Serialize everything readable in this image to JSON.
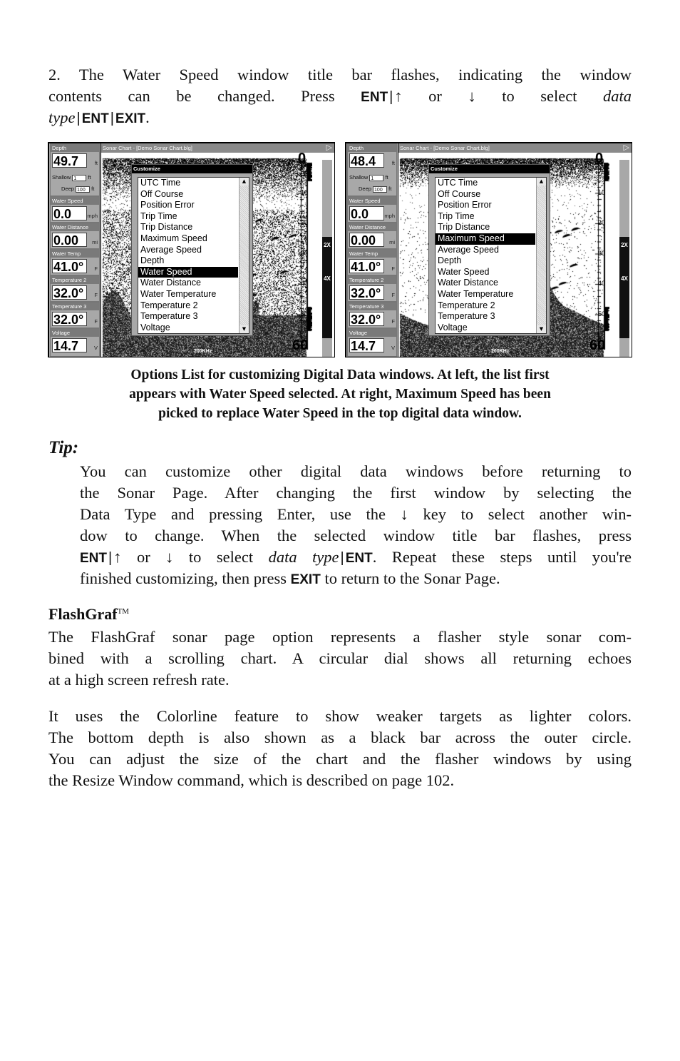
{
  "step2": {
    "line1": "2. The Water Speed window title bar flashes, indicating the window",
    "line2_a": "contents can be changed. Press",
    "key_ent": "ENT",
    "sep": "|",
    "up_arrow": "↑",
    "word_or": "or",
    "down_arrow": "↓",
    "line2_b": "to select",
    "data_word": "data",
    "type_word": "type",
    "key_exit": "EXIT",
    "period": "."
  },
  "screenshots": [
    {
      "side": "left",
      "chart_title": "Sonar Chart - [Demo Sonar Chart.blg]",
      "digital_windows": [
        {
          "title": "Depth",
          "value": "49.7",
          "unit": "ft"
        },
        {
          "title": "Water Speed",
          "value": "0.0",
          "unit": "mph"
        },
        {
          "title": "Water Distance",
          "value": "0.00",
          "unit": "mi"
        },
        {
          "title": "Water Temp",
          "value": "41.0°",
          "unit": "F"
        },
        {
          "title": "Temperature 2",
          "value": "32.0°",
          "unit": "F"
        },
        {
          "title": "Temperature 3",
          "value": "32.0°",
          "unit": "F"
        },
        {
          "title": "Voltage",
          "value": "14.7",
          "unit": "V"
        }
      ],
      "shallow_label": "Shallow",
      "shallow_value": "1",
      "shallow_unit": "ft",
      "deep_label": "Deep",
      "deep_value": "100",
      "deep_unit": "ft",
      "customize_title": "Customize",
      "selected_index": 8,
      "options": [
        "UTC Time",
        "Off Course",
        "Position Error",
        "Trip Time",
        "Trip Distance",
        "Maximum Speed",
        "Average Speed",
        "Depth",
        "Water Speed",
        "Water Distance",
        "Water Temperature",
        "Temperature 2",
        "Temperature 3",
        "Voltage"
      ],
      "depth_scale_top": "0",
      "depth_scale_bottom": "60",
      "depth_scale_ticks": [
        "10",
        "20",
        "30",
        "40",
        "50"
      ],
      "zoom_labels": [
        "2X",
        "4X"
      ],
      "frequency": "200KHz",
      "play_icon": "▷"
    },
    {
      "side": "right",
      "chart_title": "Sonar Chart - [Demo Sonar Chart.blg]",
      "digital_windows": [
        {
          "title": "Depth",
          "value": "48.4",
          "unit": "ft"
        },
        {
          "title": "Water Speed",
          "value": "0.0",
          "unit": "mph"
        },
        {
          "title": "Water Distance",
          "value": "0.00",
          "unit": "mi"
        },
        {
          "title": "Water Temp",
          "value": "41.0°",
          "unit": "F"
        },
        {
          "title": "Temperature 2",
          "value": "32.0°",
          "unit": "F"
        },
        {
          "title": "Temperature 3",
          "value": "32.0°",
          "unit": "F"
        },
        {
          "title": "Voltage",
          "value": "14.7",
          "unit": "V"
        }
      ],
      "shallow_label": "Shallow",
      "shallow_value": "1",
      "shallow_unit": "ft",
      "deep_label": "Deep",
      "deep_value": "100",
      "deep_unit": "ft",
      "customize_title": "Customize",
      "selected_index": 5,
      "options": [
        "UTC Time",
        "Off Course",
        "Position Error",
        "Trip Time",
        "Trip Distance",
        "Maximum Speed",
        "Average Speed",
        "Depth",
        "Water Speed",
        "Water Distance",
        "Water Temperature",
        "Temperature 2",
        "Temperature 3",
        "Voltage"
      ],
      "depth_scale_top": "0",
      "depth_scale_bottom": "60",
      "depth_scale_ticks": [
        "10",
        "20",
        "30",
        "40",
        "50"
      ],
      "zoom_labels": [
        "2X",
        "4X"
      ],
      "frequency": "200KHz",
      "play_icon": "▷"
    }
  ],
  "caption": {
    "line1": "Options List for customizing Digital Data windows. At left, the list first",
    "line2": "appears with Water Speed selected. At right, Maximum Speed has been",
    "line3": "picked to replace Water Speed in the top digital data window."
  },
  "tip": {
    "heading": "Tip:",
    "line1": "You can customize other digital data windows before returning to",
    "line2": "the Sonar Page. After changing the first window by selecting the",
    "line3_a": "Data Type and pressing Enter, use the",
    "line3_b": "key to select another win-",
    "line4": "dow to change. When the selected window title bar flashes, press",
    "line5_a": "or",
    "line5_b": "to select",
    "line5_c": "data type",
    "line5_d": ". Repeat these steps until you're",
    "line6_a": "finished customizing, then press",
    "line6_b": "to return to the Sonar Page."
  },
  "flashgraf": {
    "heading": "FlashGraf",
    "tm": "TM",
    "para1_l1": "The FlashGraf sonar page option represents a flasher style sonar com-",
    "para1_l2": "bined with a scrolling chart. A circular dial shows all returning echoes",
    "para1_l3": "at a high screen refresh rate.",
    "para2_l1": "It uses the Colorline feature to show weaker targets as lighter colors.",
    "para2_l2": "The bottom depth is also shown as a black bar across the outer circle.",
    "para2_l3": "You can adjust the size of the chart and the flasher windows by using",
    "para2_l4": "the Resize Window command, which is described on page 102."
  }
}
